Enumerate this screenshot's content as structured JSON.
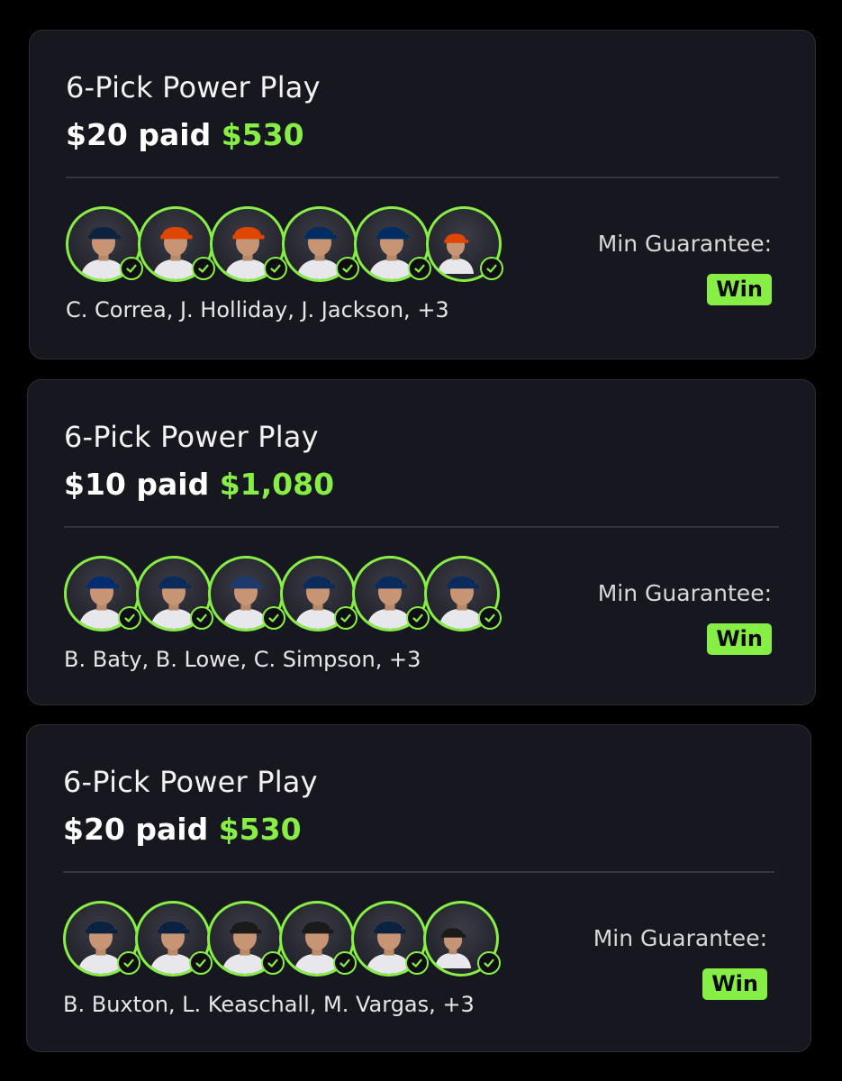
{
  "colors": {
    "accent": "#86ee45",
    "card_bg": "#17171f",
    "page_bg": "#000000"
  },
  "cards": [
    {
      "title": "6-Pick Power Play",
      "paid_text": "$20 paid",
      "payout": "$530",
      "players_text": "C. Correa, J. Holliday, J. Jackson, +3",
      "min_guarantee_label": "Min Guarantee:",
      "result_badge": "Win",
      "player_caps": [
        "#0c2340",
        "#df4601",
        "#df4601",
        "#002d62",
        "#002d62",
        "split"
      ],
      "picks_complete": 6
    },
    {
      "title": "6-Pick Power Play",
      "paid_text": "$10 paid",
      "payout": "$1,080",
      "players_text": "B. Baty, B. Lowe, C. Simpson, +3",
      "min_guarantee_label": "Min Guarantee:",
      "result_badge": "Win",
      "player_caps": [
        "#002d72",
        "#092c5c",
        "#1e3a6d",
        "#092c5c",
        "#092c5c",
        "#092c5c"
      ],
      "picks_complete": 6
    },
    {
      "title": "6-Pick Power Play",
      "paid_text": "$20 paid",
      "payout": "$530",
      "players_text": "B. Buxton, L. Keaschall, M. Vargas, +3",
      "min_guarantee_label": "Min Guarantee:",
      "result_badge": "Win",
      "player_caps": [
        "#0c2340",
        "#0c2340",
        "#1a1a1a",
        "#1a1a1a",
        "#0c2340",
        "split"
      ],
      "picks_complete": 6
    }
  ]
}
